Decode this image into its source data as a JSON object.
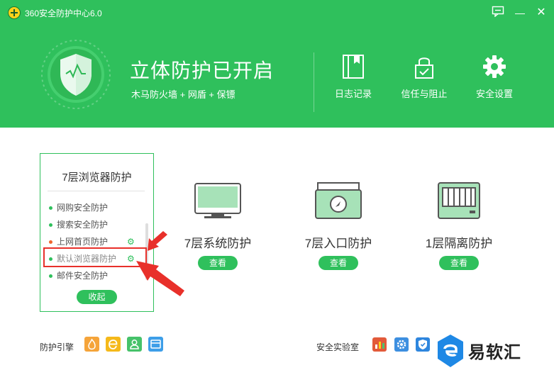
{
  "window": {
    "title": "360安全防护中心6.0",
    "feedback_icon": "feedback-icon",
    "minimize": "—",
    "close": "✕"
  },
  "hero": {
    "title": "立体防护已开启",
    "subtitle": "木马防火墙 + 网盾 + 保镖"
  },
  "header_actions": [
    {
      "label": "日志记录",
      "icon": "log-book-icon"
    },
    {
      "label": "信任与阻止",
      "icon": "lock-check-icon"
    },
    {
      "label": "安全设置",
      "icon": "gear-icon"
    }
  ],
  "browser_card": {
    "title": "7层浏览器防护",
    "items": [
      {
        "label": "网购安全防护",
        "status": "green"
      },
      {
        "label": "搜索安全防护",
        "status": "green"
      },
      {
        "label": "上网首页防护",
        "status": "red",
        "has_settings": true
      },
      {
        "label": "默认浏览器防护",
        "status": "green",
        "has_settings": true
      },
      {
        "label": "邮件安全防护",
        "status": "green"
      }
    ],
    "collapse_label": "收起"
  },
  "features": [
    {
      "name": "7层系统防护",
      "button": "查看",
      "icon": "monitor-icon"
    },
    {
      "name": "7层入口防护",
      "button": "查看",
      "icon": "entry-device-icon"
    },
    {
      "name": "1层隔离防护",
      "button": "查看",
      "icon": "isolation-box-icon"
    }
  ],
  "footer": {
    "engine_label": "防护引擎",
    "engine_icons": [
      "fire-engine-icon",
      "ie-engine-icon",
      "user-engine-icon",
      "card-engine-icon"
    ],
    "lab_label": "安全实验室",
    "lab_icons": [
      "lab-chart-icon",
      "lab-gear-icon",
      "lab-shield-icon"
    ]
  },
  "watermark": {
    "text": "易软汇"
  },
  "colors": {
    "brand_green": "#2fc05c",
    "highlight_red": "#e8302a",
    "warning_dot": "#f0642d"
  }
}
